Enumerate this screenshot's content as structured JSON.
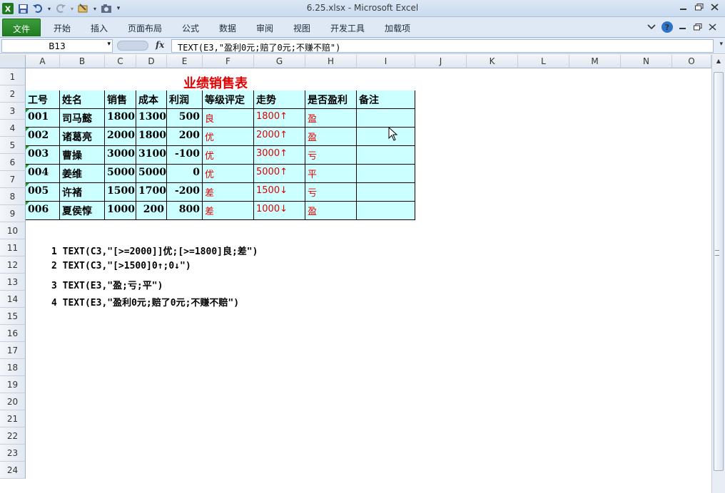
{
  "window": {
    "title": "6.25.xlsx - Microsoft Excel"
  },
  "ribbon": {
    "tabs": [
      "文件",
      "开始",
      "插入",
      "页面布局",
      "公式",
      "数据",
      "审阅",
      "视图",
      "开发工具",
      "加载项"
    ]
  },
  "formula_bar": {
    "name_box": "B13",
    "fx": "fx",
    "formula": "TEXT(E3,\"盈利0元;赔了0元;不赚不赔\")"
  },
  "columns": [
    "A",
    "B",
    "C",
    "D",
    "E",
    "F",
    "G",
    "H",
    "I",
    "J",
    "K",
    "L",
    "M",
    "N",
    "O"
  ],
  "rows": [
    "1",
    "2",
    "3",
    "4",
    "5",
    "6",
    "7",
    "8",
    "9",
    "10",
    "11",
    "12",
    "13",
    "14",
    "15",
    "16",
    "17",
    "18",
    "19",
    "20",
    "21",
    "22",
    "23",
    "24"
  ],
  "sheet": {
    "title": "业绩销售表",
    "headers": [
      "工号",
      "姓名",
      "销售",
      "成本",
      "利润",
      "等级评定",
      "走势",
      "是否盈利",
      "备注"
    ],
    "records": [
      {
        "id": "001",
        "name": "司马懿",
        "sales": "1800",
        "cost": "1300",
        "profit": "500",
        "grade": "良",
        "trend": "1800↑",
        "gain": "盈",
        "note": ""
      },
      {
        "id": "002",
        "name": "诸葛亮",
        "sales": "2000",
        "cost": "1800",
        "profit": "200",
        "grade": "优",
        "trend": "2000↑",
        "gain": "盈",
        "note": ""
      },
      {
        "id": "003",
        "name": "曹操",
        "sales": "3000",
        "cost": "3100",
        "profit": "-100",
        "grade": "优",
        "trend": "3000↑",
        "gain": "亏",
        "note": ""
      },
      {
        "id": "004",
        "name": "姜维",
        "sales": "5000",
        "cost": "5000",
        "profit": "0",
        "grade": "优",
        "trend": "5000↑",
        "gain": "平",
        "note": ""
      },
      {
        "id": "005",
        "name": "许褚",
        "sales": "1500",
        "cost": "1700",
        "profit": "-200",
        "grade": "差",
        "trend": "1500↓",
        "gain": "亏",
        "note": ""
      },
      {
        "id": "006",
        "name": "夏侯惇",
        "sales": "1000",
        "cost": "200",
        "profit": "800",
        "grade": "差",
        "trend": "1000↓",
        "gain": "盈",
        "note": ""
      }
    ],
    "notes": [
      "1 TEXT(C3,\"[>=2000]]优;[>=1800]良;差\")",
      "2 TEXT(C3,\"[>1500]0↑;0↓\")",
      "3 TEXT(E3,\"盈;亏;平\")",
      "4 TEXT(E3,\"盈利0元;赔了0元;不赚不赔\")"
    ]
  },
  "colors": {
    "table_fill": "#ccffff",
    "accent_red": "#e00000",
    "file_tab_green": "#2a8a2a"
  }
}
